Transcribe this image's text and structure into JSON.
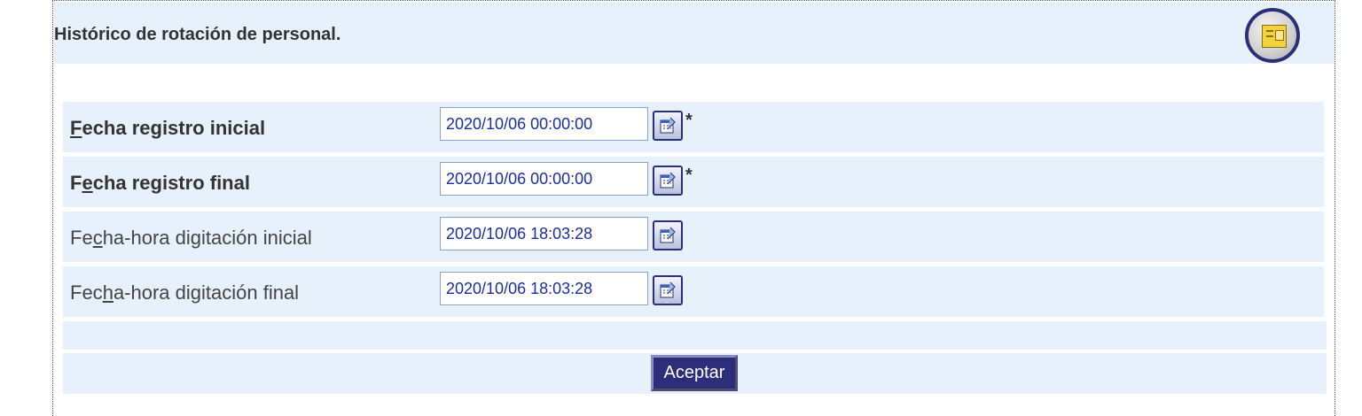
{
  "header": {
    "title": "Histórico de rotación de personal.",
    "icon": "report-icon"
  },
  "form": {
    "rows": [
      {
        "label_pre": "",
        "label_key": "F",
        "label_post": "echa registro inicial",
        "value": "2020/10/06 00:00:00",
        "required_mark": "*",
        "bold": true
      },
      {
        "label_pre": "F",
        "label_key": "e",
        "label_post": "cha registro final",
        "value": "2020/10/06 00:00:00",
        "required_mark": "*",
        "bold": true
      },
      {
        "label_pre": "Fe",
        "label_key": "c",
        "label_post": "ha-hora digitación inicial",
        "value": "2020/10/06 18:03:28",
        "required_mark": "",
        "bold": false
      },
      {
        "label_pre": "Fec",
        "label_key": "h",
        "label_post": "a-hora digitación final",
        "value": "2020/10/06 18:03:28",
        "required_mark": "",
        "bold": false
      }
    ],
    "calendar_icon": "calendar-icon"
  },
  "actions": {
    "accept_label": "Aceptar"
  },
  "colors": {
    "row_background": "#e6f1fb",
    "button_background": "#2c2e7a",
    "input_text": "#1c2f9c"
  }
}
